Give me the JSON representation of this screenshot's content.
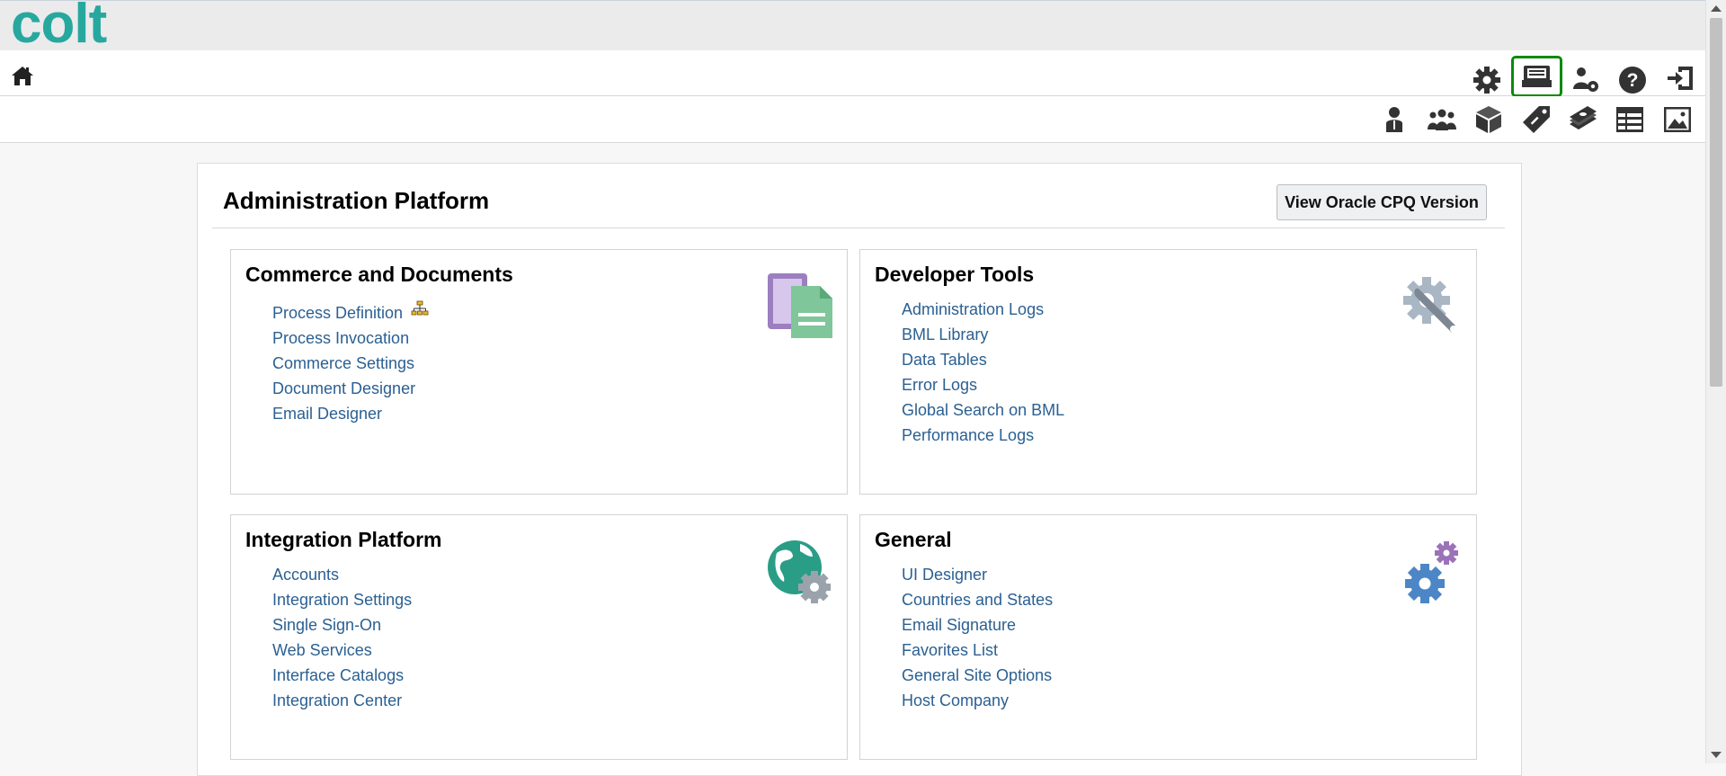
{
  "brand": {
    "logo_text": "colt",
    "logo_color": "#27a89f"
  },
  "nav": {
    "home_icon": "home-icon",
    "top_right_icons": [
      "gear-icon",
      "inbox-icon",
      "user-settings-icon",
      "help-icon",
      "logout-icon"
    ],
    "highlighted_icon": "inbox-icon",
    "highlight_color": "#0a8a0a"
  },
  "toolbar": {
    "icons": [
      "user-icon",
      "group-icon",
      "product-box-icon",
      "price-tag-icon",
      "money-stack-icon",
      "table-icon",
      "image-icon"
    ]
  },
  "page": {
    "title": "Administration Platform",
    "version_button": "View Oracle CPQ Version"
  },
  "cards": {
    "commerce": {
      "title": "Commerce and Documents",
      "links": [
        "Process Definition",
        "Process Invocation",
        "Commerce Settings",
        "Document Designer",
        "Email Designer"
      ],
      "icon": "documents-icon"
    },
    "developer": {
      "title": "Developer Tools",
      "links": [
        "Administration Logs",
        "BML Library",
        "Data Tables",
        "Error Logs",
        "Global Search on BML",
        "Performance Logs"
      ],
      "icon": "wrench-gear-icon"
    },
    "integration": {
      "title": "Integration Platform",
      "links": [
        "Accounts",
        "Integration Settings",
        "Single Sign-On",
        "Web Services",
        "Interface Catalogs",
        "Integration Center"
      ],
      "icon": "globe-gear-icon"
    },
    "general": {
      "title": "General",
      "links": [
        "UI Designer",
        "Countries and States",
        "Email Signature",
        "Favorites List",
        "General Site Options",
        "Host Company"
      ],
      "icon": "gears-icon"
    }
  },
  "colors": {
    "link": "#2b6092",
    "accent": "#27a89f"
  }
}
